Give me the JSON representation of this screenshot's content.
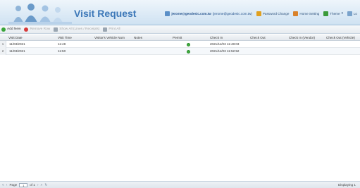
{
  "header": {
    "title": "Visit Request",
    "user_email": "jerome@geodesic.com.tw",
    "user_email_sub": "(jerome@geodesic.com.tw)",
    "links": [
      {
        "label": "Password Change",
        "icon": "key-icon",
        "color": "#e0a020"
      },
      {
        "label": "Home Setting",
        "icon": "home-icon",
        "color": "#d9822b"
      },
      {
        "label": "Theme",
        "icon": "theme-icon",
        "color": "#3a9a3a"
      }
    ],
    "extra": "Lo"
  },
  "toolbar": {
    "buttons": [
      {
        "label": "Add New",
        "icon": "add-icon",
        "color": "#3aa53a",
        "enabled": true
      },
      {
        "label": "Remove Row",
        "icon": "remove-icon",
        "color": "#d63a3a",
        "enabled": false
      },
      {
        "label": "Show All (Lines / Receipts)",
        "icon": "list-icon",
        "color": "#9aa6b2",
        "enabled": false
      },
      {
        "label": "Print All",
        "icon": "print-icon",
        "color": "#9aa6b2",
        "enabled": false
      }
    ]
  },
  "grid": {
    "columns": [
      "Visit Date",
      "Visit Time",
      "Visitor's Vehicle Num",
      "Notes",
      "Permit",
      "Check In",
      "Check Out",
      "Check In (Vendor)",
      "Check Out (Vehicle)"
    ],
    "rows": [
      {
        "num": "1",
        "visit_date": "11/03/2021",
        "visit_time": "11:48",
        "vehicle": "",
        "notes": "",
        "permit": "ok",
        "check_in": "2021/11/03 11:48:03",
        "check_out": "",
        "check_in_vendor": "",
        "check_out_vehicle": ""
      },
      {
        "num": "2",
        "visit_date": "11/03/2021",
        "visit_time": "11:50",
        "vehicle": "",
        "notes": "",
        "permit": "ok",
        "check_in": "2021/11/03 11:52:52",
        "check_out": "",
        "check_in_vendor": "",
        "check_out_vehicle": ""
      }
    ]
  },
  "pager": {
    "page_label": "Page",
    "page_value": "1",
    "of_label": "of 1",
    "right_text": "Displaying 1"
  }
}
